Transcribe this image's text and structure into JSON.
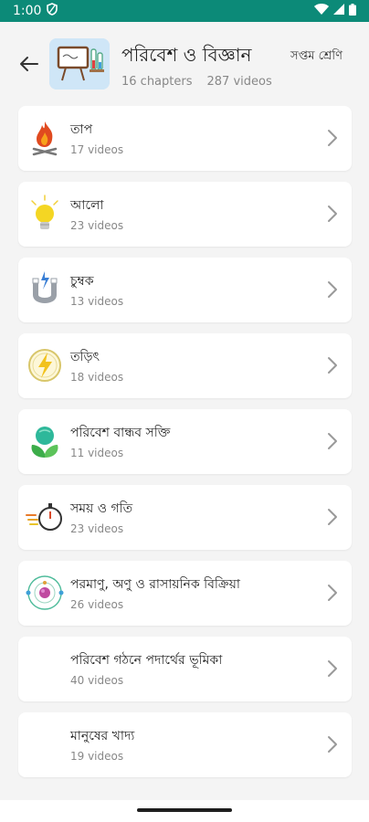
{
  "status_bar": {
    "time": "1:00"
  },
  "header": {
    "title": "পরিবেশ ও বিজ্ঞান",
    "chapters": "16 chapters",
    "videos": "287 videos",
    "class_label": "সপ্তম শ্রেণি"
  },
  "chapters": [
    {
      "name": "তাপ",
      "count": "17 videos",
      "icon": "fire-icon"
    },
    {
      "name": "আলো",
      "count": "23 videos",
      "icon": "bulb-icon"
    },
    {
      "name": "চুম্বক",
      "count": "13 videos",
      "icon": "magnet-icon"
    },
    {
      "name": "তড়িৎ",
      "count": "18 videos",
      "icon": "lightning-icon"
    },
    {
      "name": "পরিবেশ বান্ধব সক্তি",
      "count": "11 videos",
      "icon": "plant-icon"
    },
    {
      "name": "সময় ও গতি",
      "count": "23 videos",
      "icon": "stopwatch-icon"
    },
    {
      "name": "পরমাণু, অণু ও রাসায়নিক বিক্রিয়া",
      "count": "26 videos",
      "icon": "atom-icon"
    },
    {
      "name": "পরিবেশ গঠনে পদার্থের ভূমিকা",
      "count": "40 videos",
      "icon": ""
    },
    {
      "name": "মানুষের খাদ্য",
      "count": "19 videos",
      "icon": ""
    }
  ],
  "colors": {
    "status_bar": "#0c8a78",
    "background": "#f4f4f4"
  }
}
